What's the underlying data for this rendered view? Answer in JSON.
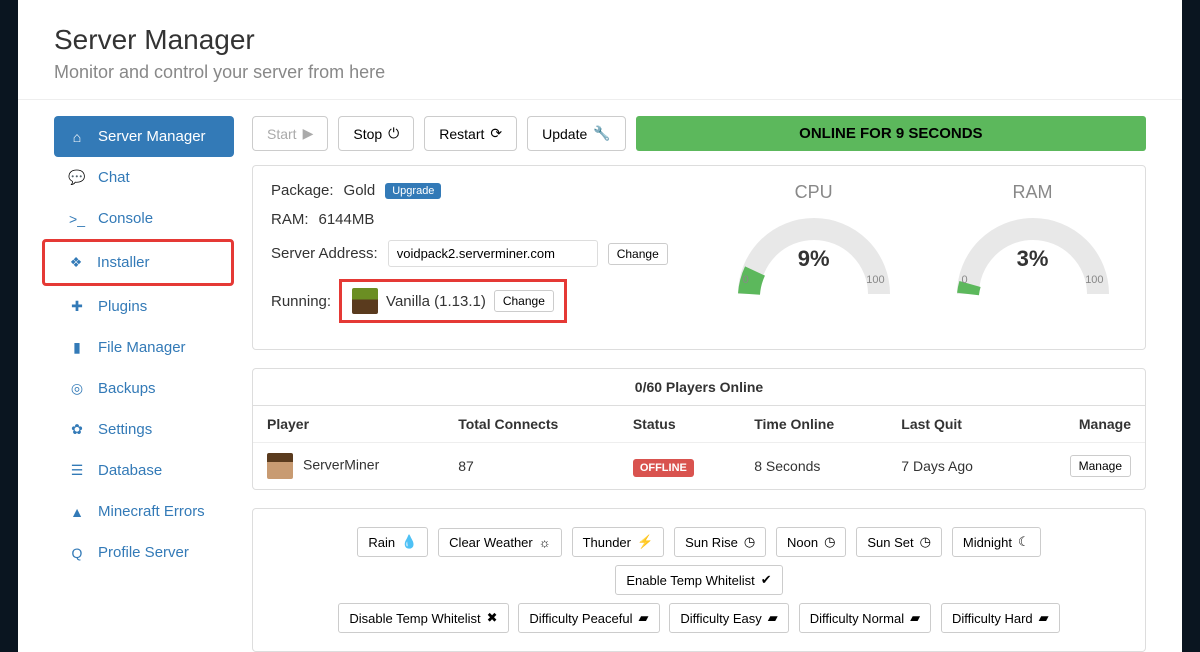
{
  "header": {
    "title": "Server Manager",
    "subtitle": "Monitor and control your server from here"
  },
  "sidebar": {
    "items": [
      {
        "label": "Server Manager",
        "icon": "home"
      },
      {
        "label": "Chat",
        "icon": "chat"
      },
      {
        "label": "Console",
        "icon": "terminal"
      },
      {
        "label": "Installer",
        "icon": "cubes"
      },
      {
        "label": "Plugins",
        "icon": "puzzle"
      },
      {
        "label": "File Manager",
        "icon": "file"
      },
      {
        "label": "Backups",
        "icon": "life-ring"
      },
      {
        "label": "Settings",
        "icon": "gear"
      },
      {
        "label": "Database",
        "icon": "database"
      },
      {
        "label": "Minecraft Errors",
        "icon": "warning"
      },
      {
        "label": "Profile Server",
        "icon": "search"
      }
    ]
  },
  "actions": {
    "start": "Start",
    "stop": "Stop",
    "restart": "Restart",
    "update": "Update"
  },
  "status_bar": "ONLINE FOR 9 SECONDS",
  "info": {
    "package_label": "Package:",
    "package_value": "Gold",
    "upgrade": "Upgrade",
    "ram_label": "RAM:",
    "ram_value": "6144MB",
    "address_label": "Server Address:",
    "address_value": "voidpack2.serverminer.com",
    "address_change": "Change",
    "running_label": "Running:",
    "running_value": "Vanilla (1.13.1)",
    "running_change": "Change"
  },
  "gauges": {
    "cpu": {
      "title": "CPU",
      "value": "9%",
      "percent": 9,
      "min": "0",
      "max": "100"
    },
    "ram": {
      "title": "RAM",
      "value": "3%",
      "percent": 3,
      "min": "0",
      "max": "100"
    }
  },
  "players": {
    "title": "0/60 Players Online",
    "cols": {
      "player": "Player",
      "connects": "Total Connects",
      "status": "Status",
      "time": "Time Online",
      "last": "Last Quit",
      "manage": "Manage"
    },
    "rows": [
      {
        "name": "ServerMiner",
        "connects": "87",
        "status": "OFFLINE",
        "time": "8 Seconds",
        "last": "7 Days Ago",
        "manage": "Manage"
      }
    ]
  },
  "quick": {
    "row1": [
      "Rain",
      "Clear Weather",
      "Thunder",
      "Sun Rise",
      "Noon",
      "Sun Set",
      "Midnight",
      "Enable Temp Whitelist"
    ],
    "row2": [
      "Disable Temp Whitelist",
      "Difficulty Peaceful",
      "Difficulty Easy",
      "Difficulty Normal",
      "Difficulty Hard"
    ]
  }
}
